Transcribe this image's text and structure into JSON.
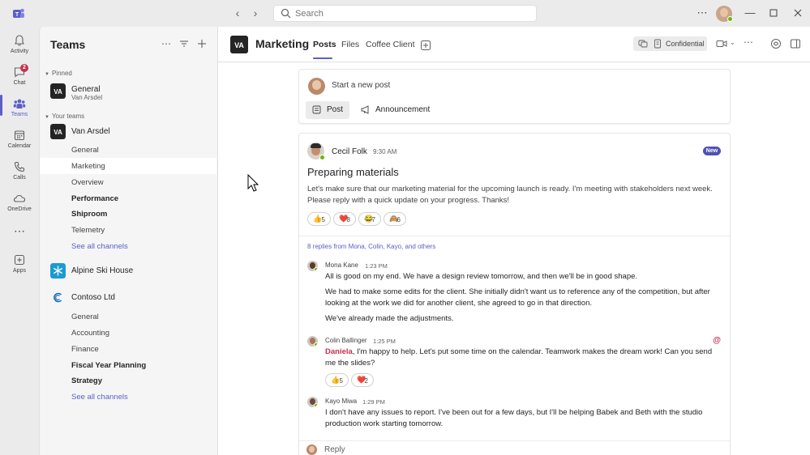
{
  "titlebar": {
    "search_placeholder": "Search"
  },
  "rail": {
    "items": [
      {
        "label": "Activity",
        "icon": "bell-icon"
      },
      {
        "label": "Chat",
        "icon": "chat-icon",
        "badge": "2"
      },
      {
        "label": "Teams",
        "icon": "teams-icon"
      },
      {
        "label": "Calendar",
        "icon": "calendar-icon"
      },
      {
        "label": "Calls",
        "icon": "phone-icon"
      },
      {
        "label": "OneDrive",
        "icon": "cloud-icon"
      },
      {
        "label": "Apps",
        "icon": "apps-icon"
      }
    ]
  },
  "teams_panel": {
    "title": "Teams",
    "pinned_label": "Pinned",
    "pinned": {
      "name": "General",
      "team": "Van Arsdel"
    },
    "your_teams_label": "Your teams",
    "teams": [
      {
        "name": "Van Arsdel",
        "channels": [
          "General",
          "Marketing",
          "Overview",
          "Performance",
          "Shiproom",
          "Telemetry"
        ],
        "see_all": "See all channels"
      },
      {
        "name": "Alpine Ski House"
      },
      {
        "name": "Contoso Ltd",
        "channels": [
          "General",
          "Accounting",
          "Finance",
          "Fiscal Year Planning",
          "Strategy"
        ],
        "see_all": "See all channels"
      }
    ]
  },
  "header": {
    "team_name": "Marketing",
    "tabs": [
      "Posts",
      "Files",
      "Coffee Client"
    ],
    "sensitivity_label": "Confidential"
  },
  "new_post": {
    "prompt": "Start a new post",
    "post_label": "Post",
    "announcement_label": "Announcement"
  },
  "post": {
    "author": "Cecil Folk",
    "time": "9:30 AM",
    "badge": "New",
    "title": "Preparing materials",
    "body": "Let's make sure that our marketing material for the upcoming launch is ready. I'm meeting with stakeholders next week. Please reply with a quick update on your progress. Thanks!",
    "reactions": [
      {
        "emoji": "👍",
        "count": "5"
      },
      {
        "emoji": "❤️",
        "count": "8"
      },
      {
        "emoji": "😂",
        "count": "7"
      },
      {
        "emoji": "🙈",
        "count": "6"
      }
    ],
    "replies_summary": "8 replies from Mona, Colin, Kayo, and others"
  },
  "replies": [
    {
      "author": "Mona Kane",
      "time": "1:23 PM",
      "paragraphs": [
        "All is good on my end. We have a design review tomorrow, and then we'll be in good shape.",
        "We had to make some edits for the client. She initially didn't want us to reference any of the competition, but after looking at the work we did for another client, she agreed to go in that direction.",
        "We've already made the adjustments."
      ]
    },
    {
      "author": "Colin Ballinger",
      "time": "1:25 PM",
      "mention": "Daniela",
      "text": ", I'm happy to help. Let's put some time on the calendar. Teamwork makes the dream work! Can you send me the slides?",
      "reactions": [
        {
          "emoji": "👍",
          "count": "5"
        },
        {
          "emoji": "❤️",
          "count": "2"
        }
      ]
    },
    {
      "author": "Kayo Miwa",
      "time": "1:29 PM",
      "text": "I don't have any issues to report. I've been out for a few days, but I'll be helping Babek and Beth with the studio production work starting tomorrow."
    }
  ],
  "reply_box": {
    "label": "Reply"
  },
  "colors": {
    "brand": "#5b5fc7",
    "mention": "#c4314b",
    "presence": "#6bb700"
  }
}
